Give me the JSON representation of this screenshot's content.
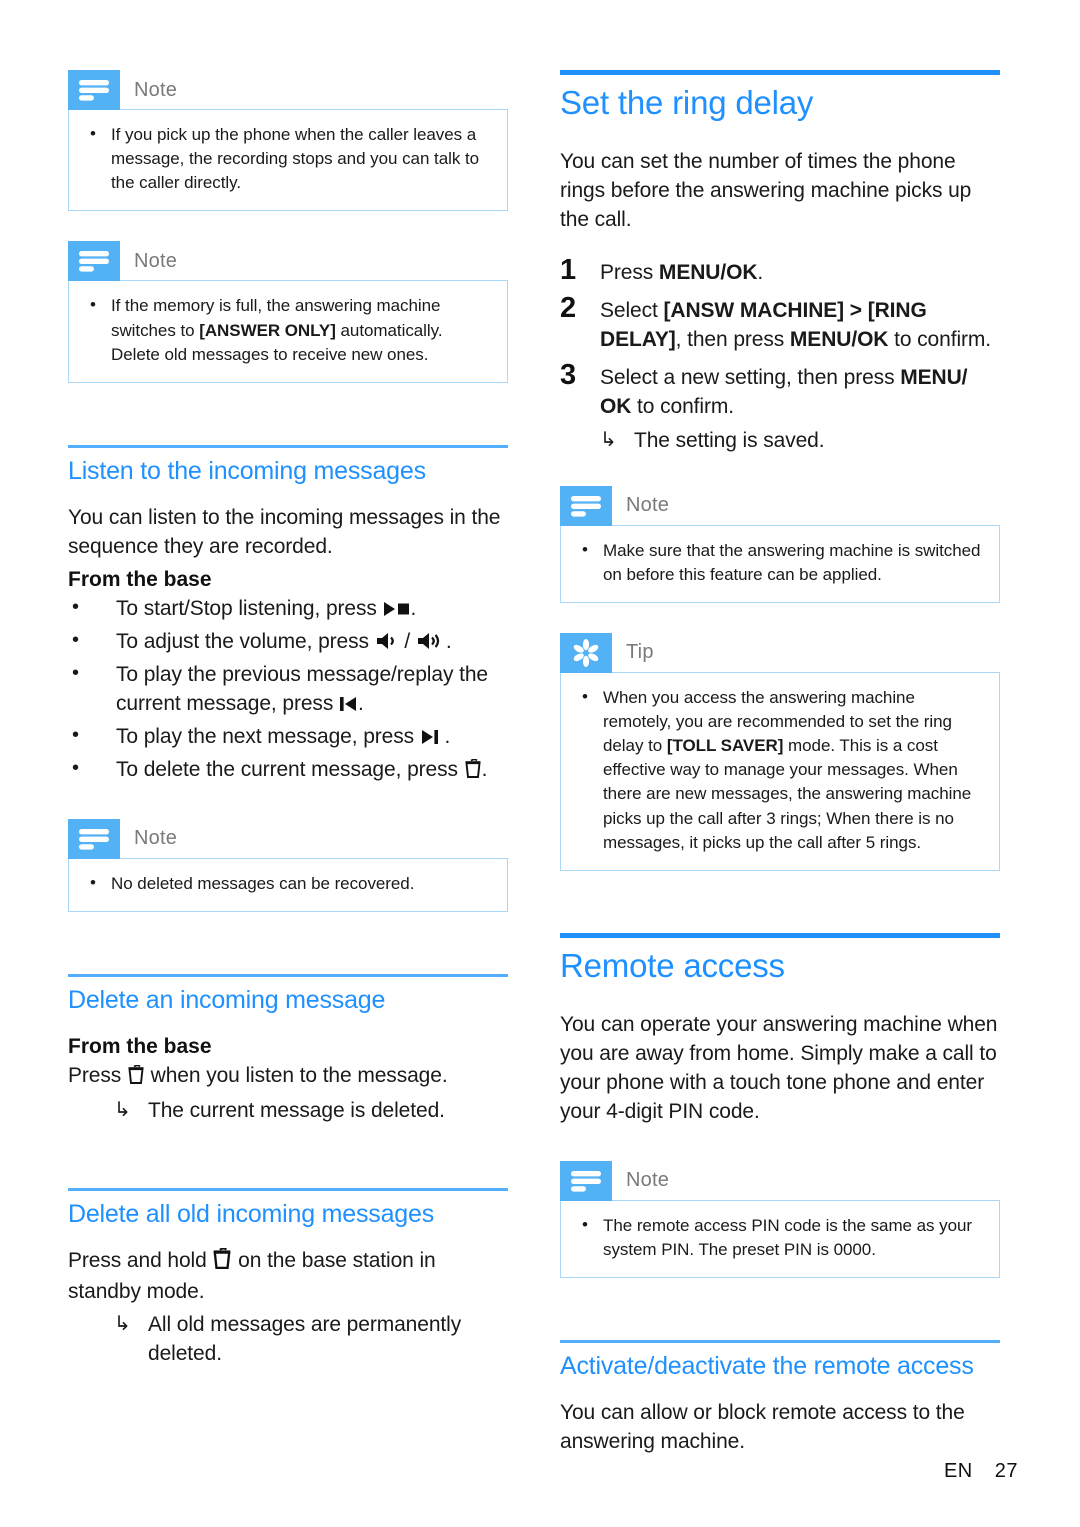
{
  "left_column": {
    "note_1": {
      "label": "Note",
      "icon": "note-lines-icon",
      "items": [
        "If you pick up the phone when the caller leaves a message, the recording stops and you can talk to the caller directly."
      ]
    },
    "note_2": {
      "label": "Note",
      "icon": "note-lines-icon",
      "text_before": "If the memory is full, the answering machine switches to ",
      "bold_term": "[ANSWER ONLY]",
      "text_after": " automatically. Delete old messages to receive new ones."
    },
    "section_listen": {
      "heading": "Listen to the incoming messages",
      "intro": "You can listen to the incoming messages in the sequence they are recorded.",
      "subheading": "From the base",
      "bullets": [
        {
          "text_before": "To start/Stop listening, press ",
          "icon": "play-stop-icon",
          "text_after": "."
        },
        {
          "text_before": "To adjust the volume, press ",
          "icon": "volume-down-icon",
          "separator": " / ",
          "icon2": "volume-up-icon",
          "text_after": "."
        },
        {
          "text_before": "To play the previous message/replay the current message, press ",
          "icon": "previous-track-icon",
          "text_after": "."
        },
        {
          "text_before": "To play the next message, press ",
          "icon": "next-track-icon",
          "text_after": " ."
        },
        {
          "text_before": "To delete the current message, press ",
          "icon": "delete-trash-icon",
          "text_after": "."
        }
      ]
    },
    "note_3": {
      "label": "Note",
      "icon": "note-lines-icon",
      "items": [
        "No deleted messages can be recovered."
      ]
    },
    "section_delete_one": {
      "heading": "Delete an incoming message",
      "subheading": "From the base",
      "line_before": "Press ",
      "icon": "delete-trash-icon",
      "line_after": " when you listen to the message.",
      "result_arrow": "↳",
      "result": "The current message is deleted."
    },
    "section_delete_all": {
      "heading": "Delete all old incoming messages",
      "line_before": "Press and hold ",
      "icon": "delete-trash-icon",
      "line_after": " on the base station in standby mode.",
      "result_arrow": "↳",
      "result": "All old messages are permanently deleted."
    }
  },
  "right_column": {
    "section_ring_delay": {
      "heading": "Set the ring delay",
      "intro": "You can set the number of times the phone rings before the answering machine picks up the call.",
      "steps": [
        {
          "num": "1",
          "plain": "Press ",
          "bold": "MENU/OK",
          "tail": "."
        },
        {
          "num": "2",
          "plain": "Select ",
          "bold": "[ANSW MACHINE] > [RING DELAY]",
          "mid": ", then press ",
          "bold2": "MENU/OK",
          "tail": " to confirm."
        },
        {
          "num": "3",
          "plain": "Select a new setting, then press ",
          "bold": "MENU/ OK",
          "tail": " to confirm."
        }
      ],
      "result_arrow": "↳",
      "result": "The setting is saved."
    },
    "note_ring": {
      "label": "Note",
      "icon": "note-lines-icon",
      "items": [
        "Make sure that the answering machine is switched on before this feature can be applied."
      ]
    },
    "tip_ring": {
      "label": "Tip",
      "icon": "tip-asterisk-icon",
      "text_before": "When you access the answering machine remotely, you are recommended to set the ring delay to ",
      "bold_term": "[TOLL SAVER]",
      "text_after": " mode. This is a cost effective way to manage your messages. When there are new messages, the answering machine picks up the call after 3 rings; When there is no messages, it picks up the call after 5 rings."
    },
    "section_remote_access": {
      "heading": "Remote access",
      "intro": "You can operate your answering machine when you are away from home. Simply make a call to your phone with a touch tone phone and enter your 4-digit PIN code."
    },
    "note_pin": {
      "label": "Note",
      "icon": "note-lines-icon",
      "items": [
        "The remote access PIN code is the same as your system PIN. The preset PIN is 0000."
      ]
    },
    "section_activate": {
      "heading": "Activate/deactivate the remote access",
      "intro": "You can allow or block remote access to the answering machine."
    }
  },
  "footer": {
    "language": "EN",
    "page_number": "27"
  },
  "colors": {
    "heading_blue": "#1e90ff",
    "rule_blue": "#53aeff",
    "badge_blue": "#53b2f5",
    "box_border": "#aad6f7",
    "label_gray": "#7a7a7a"
  }
}
